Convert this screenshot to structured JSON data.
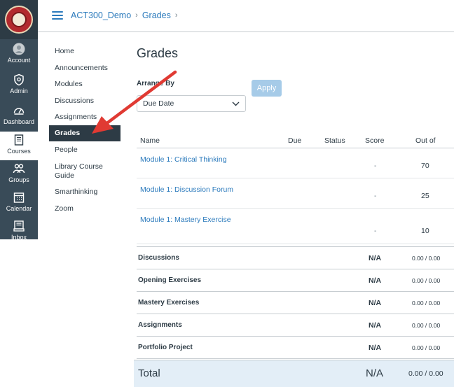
{
  "global_nav": {
    "items": [
      {
        "label": "Account",
        "icon": "account-icon"
      },
      {
        "label": "Admin",
        "icon": "admin-shield-icon"
      },
      {
        "label": "Dashboard",
        "icon": "dashboard-icon"
      },
      {
        "label": "Courses",
        "icon": "courses-book-icon"
      },
      {
        "label": "Groups",
        "icon": "groups-icon"
      },
      {
        "label": "Calendar",
        "icon": "calendar-icon"
      },
      {
        "label": "Inbox",
        "icon": "inbox-icon"
      }
    ],
    "active": "Courses"
  },
  "breadcrumb": {
    "course": "ACT300_Demo",
    "page": "Grades",
    "sep": "›"
  },
  "course_nav": {
    "items": [
      "Home",
      "Announcements",
      "Modules",
      "Discussions",
      "Assignments",
      "Grades",
      "People",
      "Library Course Guide",
      "Smarthinking",
      "Zoom"
    ],
    "active": "Grades"
  },
  "main": {
    "title": "Grades",
    "arrange_by_label": "Arrange By",
    "arrange_select_value": "Due Date",
    "apply_label": "Apply"
  },
  "table": {
    "headers": {
      "name": "Name",
      "due": "Due",
      "status": "Status",
      "score": "Score",
      "out_of": "Out of"
    },
    "assignments": [
      {
        "name": "Module 1: Critical Thinking",
        "score": "-",
        "out_of": "70"
      },
      {
        "name": "Module 1: Discussion Forum",
        "score": "-",
        "out_of": "25"
      },
      {
        "name": "Module 1: Mastery Exercise",
        "score": "-",
        "out_of": "10"
      }
    ],
    "groups": [
      {
        "name": "Discussions",
        "score": "N/A",
        "out_of": "0.00 / 0.00"
      },
      {
        "name": "Opening Exercises",
        "score": "N/A",
        "out_of": "0.00 / 0.00"
      },
      {
        "name": "Mastery Exercises",
        "score": "N/A",
        "out_of": "0.00 / 0.00"
      },
      {
        "name": "Assignments",
        "score": "N/A",
        "out_of": "0.00 / 0.00"
      },
      {
        "name": "Portfolio Project",
        "score": "N/A",
        "out_of": "0.00 / 0.00"
      }
    ],
    "total": {
      "name": "Total",
      "score": "N/A",
      "out_of": "0.00 / 0.00"
    }
  },
  "colors": {
    "nav_bg": "#394b58",
    "link": "#2b7abc",
    "annotation_arrow": "#e03a33",
    "total_bg": "#e3eef7"
  }
}
